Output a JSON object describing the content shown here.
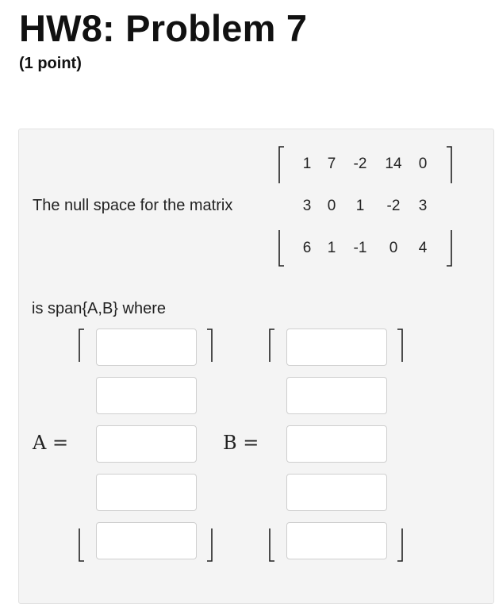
{
  "header": {
    "title": "HW8: Problem 7",
    "points": "(1 point)"
  },
  "problem": {
    "intro": "The null space for the matrix",
    "matrix": [
      [
        "1",
        "7",
        "-2",
        "14",
        "0"
      ],
      [
        "3",
        "0",
        "1",
        "-2",
        "3"
      ],
      [
        "6",
        "1",
        "-1",
        "0",
        "4"
      ]
    ],
    "span_text": "is span{A,B} where",
    "vectors": [
      {
        "label": "A =",
        "entries": [
          "",
          "",
          "",
          "",
          ""
        ]
      },
      {
        "label": "B =",
        "entries": [
          "",
          "",
          "",
          "",
          ""
        ]
      }
    ]
  }
}
